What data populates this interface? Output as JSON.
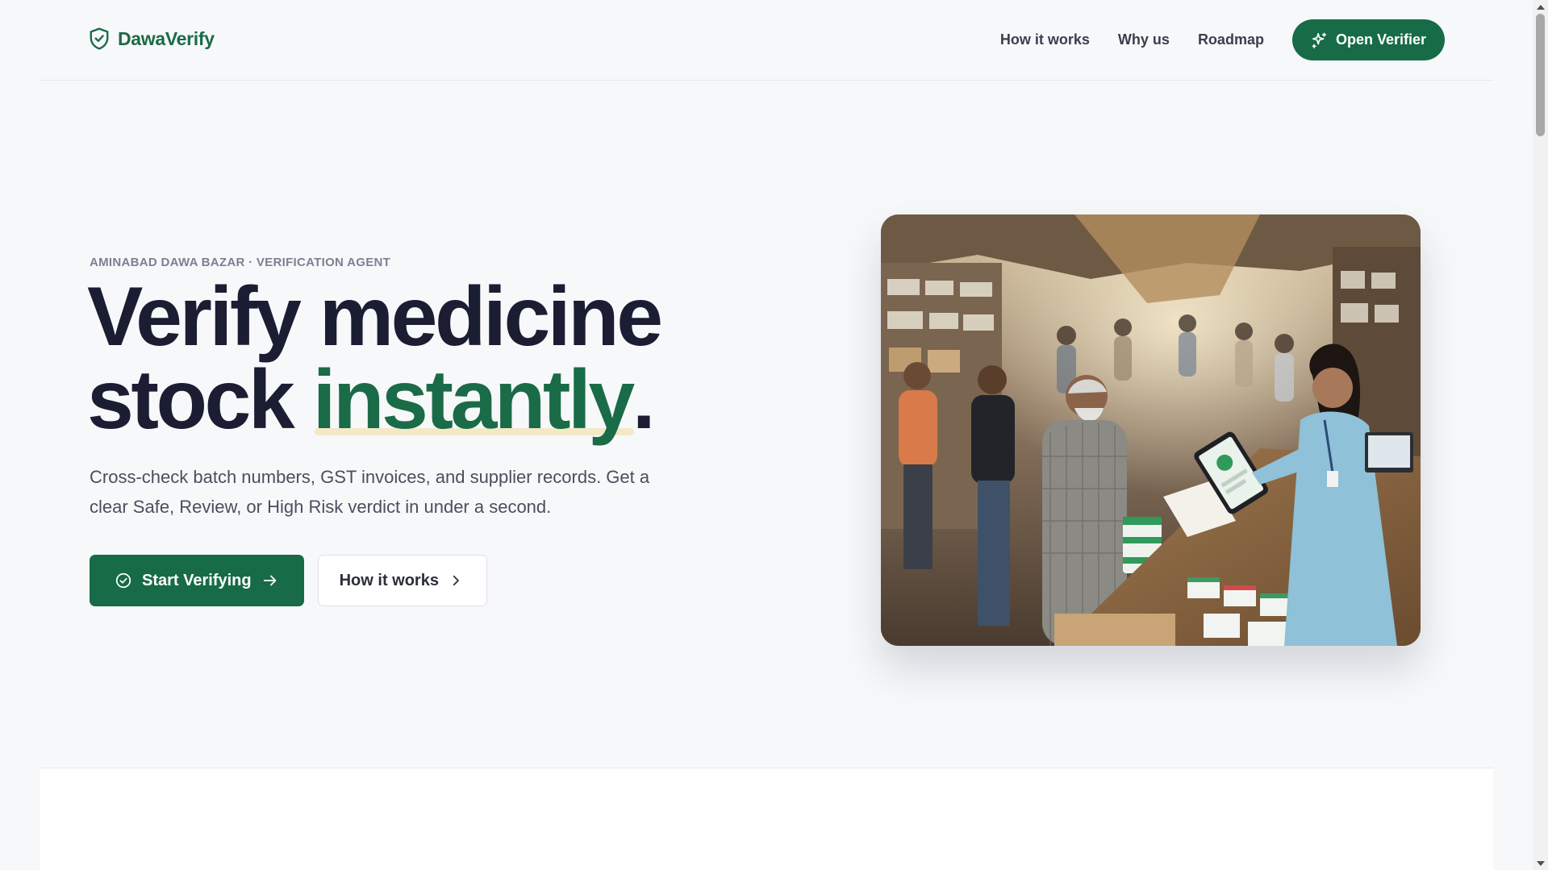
{
  "brand": {
    "name": "DawaVerify",
    "logo_icon": "shield-check-icon",
    "color": "#1a6b47"
  },
  "nav": {
    "links": [
      "How it works",
      "Why us",
      "Roadmap"
    ],
    "cta_label": "Open Verifier",
    "cta_icon": "sparkles-icon"
  },
  "hero": {
    "eyebrow": "AMINABAD DAWA BAZAR · VERIFICATION AGENT",
    "headline_line1": "Verify medicine",
    "headline_line2_prefix": "stock ",
    "headline_accent": "instantly",
    "headline_suffix": ".",
    "subtext": "Cross-check batch numbers, GST invoices, and supplier records. Get a clear Safe, Review, or High Risk verdict in under a second.",
    "primary_cta": {
      "label": "Start Verifying",
      "icon": "check-circle-icon",
      "trailing_icon": "arrow-right-icon"
    },
    "secondary_cta": {
      "label": "How it works",
      "trailing_icon": "chevron-right-icon"
    },
    "image": "pharmacist-verifying-medicine-with-tablet-in-market"
  },
  "colors": {
    "accent": "#176b47",
    "background": "#f7f8fa",
    "heading": "#1b1d33",
    "highlight": "#f3e9c6"
  }
}
